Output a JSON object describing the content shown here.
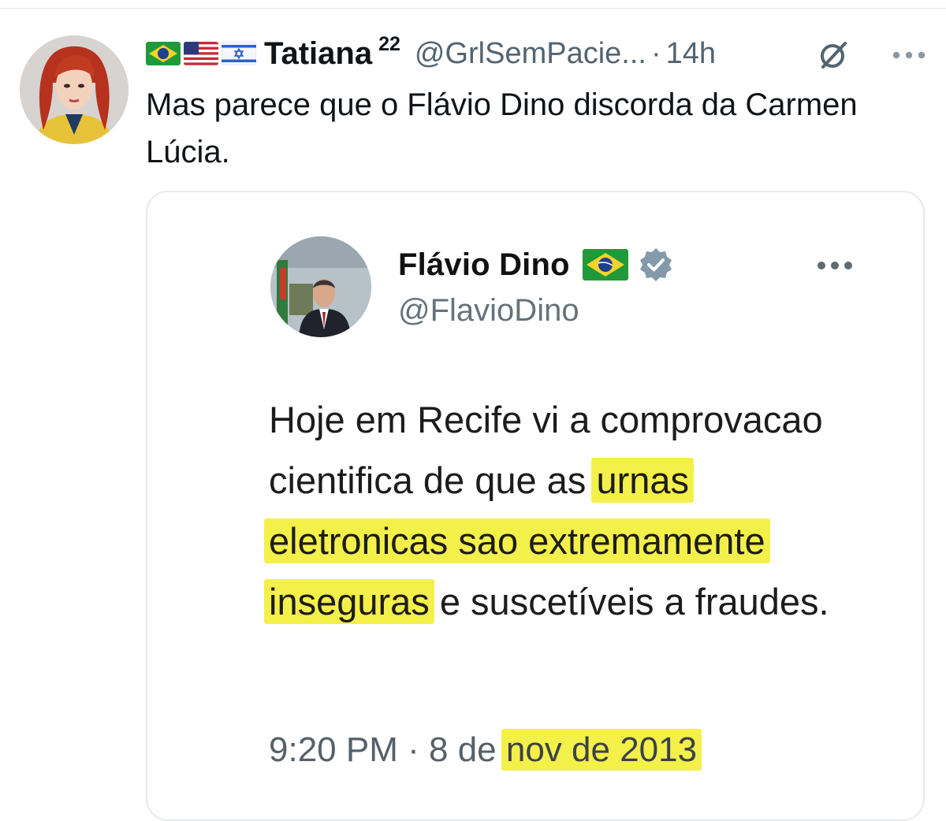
{
  "post": {
    "author": {
      "name": "Tatiana",
      "badge": "22",
      "handle": "@GrlSemPacie...",
      "flags": [
        "brazil-flag",
        "usa-flag",
        "israel-flag"
      ],
      "avatar": "illustrated-red-hair-woman-avatar"
    },
    "separator": "·",
    "time": "14h",
    "text": "Mas parece que o Flávio Dino discorda da Carmen Lúcia.",
    "icons": {
      "grok": "grok-icon",
      "more": "more-icon"
    }
  },
  "quoted": {
    "author": {
      "name": "Flávio Dino",
      "handle": "@FlavioDino",
      "flag": "brazil-flag",
      "verified": true,
      "avatar": "man-in-suit-photo-avatar"
    },
    "text_parts": [
      {
        "text": "Hoje em Recife vi a comprovacao cientifica de que as ",
        "highlight": false
      },
      {
        "text": "urnas eletronicas sao extremamente inseguras",
        "highlight": true
      },
      {
        "text": " e suscetíveis a fraudes.",
        "highlight": false
      }
    ],
    "time": "9:20 PM",
    "separator": "·",
    "date_plain": "8 de",
    "date_highlight": "nov de 2013"
  },
  "colors": {
    "text": "#0f1419",
    "secondary": "#536471",
    "highlight": "#f4f04a",
    "border": "#e7e9ea",
    "verified": "#829aab"
  }
}
